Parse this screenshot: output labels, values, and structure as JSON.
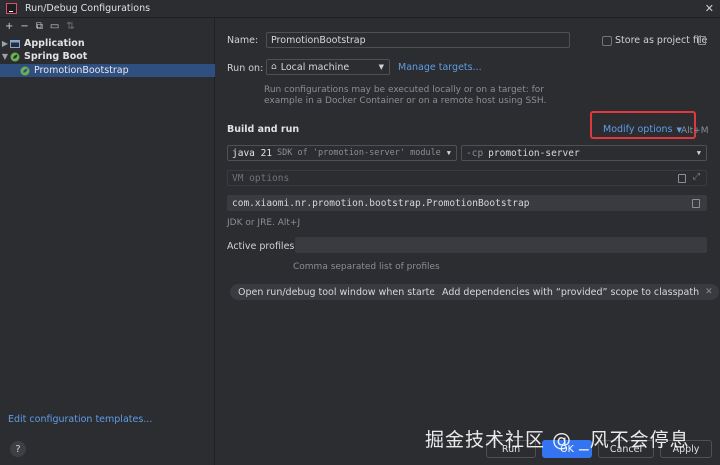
{
  "window": {
    "title": "Run/Debug Configurations",
    "close_glyph": "✕"
  },
  "left_toolbar": {
    "items": [
      {
        "name": "add-icon",
        "glyph": "+"
      },
      {
        "name": "remove-icon",
        "glyph": "−"
      },
      {
        "name": "copy-icon",
        "glyph": "⧉"
      },
      {
        "name": "folder-icon",
        "glyph": "▭"
      },
      {
        "name": "sort-icon",
        "glyph": "⇅"
      }
    ]
  },
  "tree": {
    "items": [
      {
        "label": "Application",
        "expanded": false,
        "icon": "application-icon"
      },
      {
        "label": "Spring Boot",
        "expanded": true,
        "icon": "spring-boot-icon"
      },
      {
        "label": "PromotionBootstrap",
        "selected": true,
        "icon": "spring-config-icon"
      }
    ]
  },
  "edit_templates_label": "Edit configuration templates...",
  "form": {
    "name_label": "Name:",
    "name_value": "PromotionBootstrap",
    "store_as_project_label": "Store as project file",
    "run_on_label": "Run on:",
    "run_on_value": "Local machine",
    "manage_targets_label": "Manage targets...",
    "run_on_hint_line1": "Run configurations may be executed locally or on a target: for",
    "run_on_hint_line2": "example in a Docker Container or on a remote host using SSH.",
    "build_run_label": "Build and run",
    "modify_options_label": "Modify options",
    "modify_options_shortcut": "Alt+M",
    "jdk_value": "java 21",
    "jdk_hint": "SDK of 'promotion-server' module",
    "cp_prefix": "-cp",
    "cp_value": "promotion-server",
    "vm_options_placeholder": "VM options",
    "main_class_value": "com.xiaomi.nr.promotion.bootstrap.PromotionBootstrap",
    "jdk_footer_hint": "JDK or JRE. Alt+J",
    "active_profiles_label": "Active profiles:",
    "active_profiles_value": "",
    "active_profiles_hint": "Comma separated list of profiles",
    "chips": [
      {
        "label": "Open run/debug tool window when started"
      },
      {
        "label": "Add dependencies with “provided” scope to classpath"
      }
    ]
  },
  "buttons": {
    "help": "?",
    "run": "Run",
    "ok": "OK",
    "cancel": "Cancel",
    "apply": "Apply"
  },
  "watermark": "掘金技术社区 @ _风不会停息",
  "colors": {
    "background": "#2b2d30",
    "selection": "#2e4f80",
    "accent_link": "#5f9de8",
    "primary_button": "#3574f0",
    "highlight": "#e0383d"
  }
}
